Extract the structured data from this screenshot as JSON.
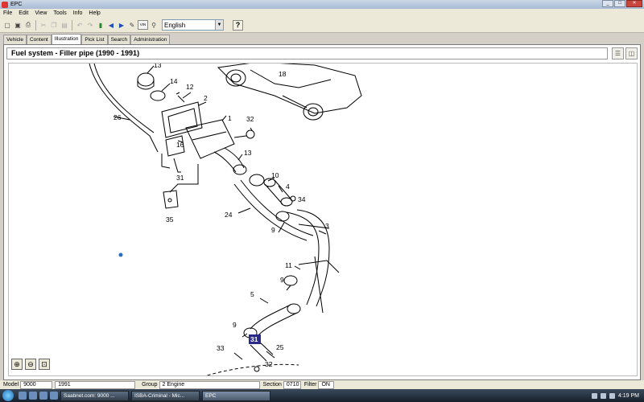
{
  "window": {
    "title": "EPC"
  },
  "menu": [
    "File",
    "Edit",
    "View",
    "Tools",
    "Info",
    "Help"
  ],
  "toolbar": {
    "vin_label": "VIN",
    "language": "English",
    "help_label": "?"
  },
  "tabs": [
    "Vehicle",
    "Content",
    "Illustration",
    "Pick List",
    "Search",
    "Administration"
  ],
  "active_tab": "Illustration",
  "heading": "Fuel system - Filler pipe   (1990 - 1991)",
  "callouts": [
    "1",
    "2",
    "3",
    "4",
    "5",
    "9",
    "9",
    "10",
    "11",
    "12",
    "13",
    "14",
    "15",
    "16",
    "18",
    "24",
    "26",
    "27",
    "28",
    "31",
    "32",
    "33",
    "34",
    "35",
    "25"
  ],
  "selected_callout": "31",
  "status": {
    "model_label": "Model",
    "model": "9000",
    "year": "1991",
    "group_label": "Group",
    "group": "2 Engine",
    "section_label": "Section",
    "section": "0710",
    "filter_label": "Filter",
    "filter": "ON"
  },
  "taskbar": {
    "tasks": [
      "Saabnet.com: 9000 ...",
      "ISBA-Criminal - Mic...",
      "EPC"
    ],
    "clock": "4:19 PM"
  },
  "colors": {
    "selected_callout_bg": "#2a2a8a",
    "accent": "#3a6ea5"
  }
}
